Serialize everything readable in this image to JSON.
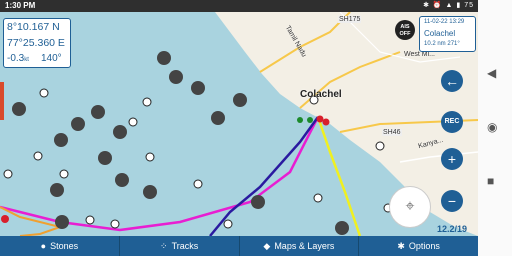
{
  "status": {
    "time": "1:30 PM",
    "right_icons": "✱ ⏰ ▲ ▮ 75"
  },
  "coords": {
    "lat": "8°10.167 N",
    "lon": "77°25.360 E",
    "speed": "-0.3",
    "speed_unit": "kt",
    "heading": "140°"
  },
  "info": {
    "datetime": "11-02-22 13:29",
    "place": "Colachel",
    "distance": "10.2 nm",
    "bearing": "271°"
  },
  "ais": {
    "line1": "AIS",
    "line2": "OFF"
  },
  "map": {
    "place_colachel": "Colachel",
    "place_west": "West Mi...",
    "road_tamil": "Tamil Nadu",
    "road_sh175": "SH175",
    "road_sh46": "SH46",
    "road_kanya": "Kanya..."
  },
  "fabs": {
    "back": "←",
    "rec": "REC",
    "zoom_in": "+",
    "zoom_out": "−"
  },
  "scale": "12.2/19",
  "tabs": [
    {
      "label": "Stones",
      "icon": "location-pin-icon"
    },
    {
      "label": "Tracks",
      "icon": "track-icon"
    },
    {
      "label": "Maps & Layers",
      "icon": "layers-icon"
    },
    {
      "label": "Options",
      "icon": "gear-icon"
    }
  ],
  "colors": {
    "accent": "#1f5f95",
    "track_magenta": "#e81ed2",
    "track_navy": "#2a1aa0",
    "track_yellow": "#f0f020"
  }
}
